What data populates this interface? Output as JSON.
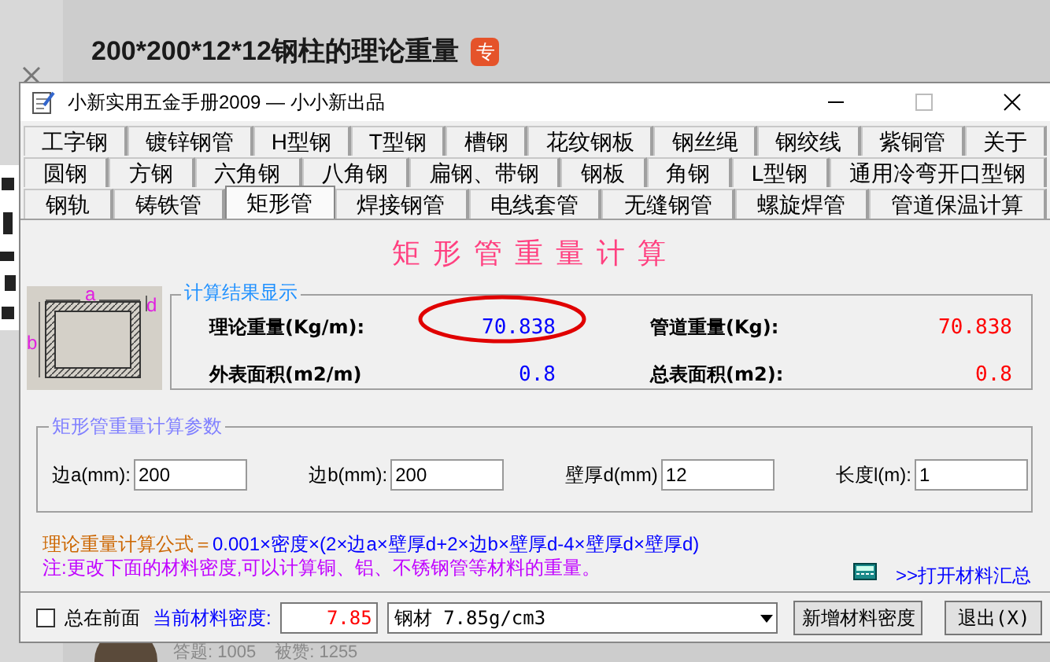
{
  "page": {
    "heading": "200*200*12*12钢柱的理论重量",
    "badge": "专",
    "stats": [
      {
        "label": "答题:",
        "value": "1005"
      },
      {
        "label": "被赞:",
        "value": "1255"
      }
    ]
  },
  "window": {
    "title": "小新实用五金手册2009 — 小小新出品"
  },
  "tab_rows": [
    [
      {
        "label": "工字钢",
        "selected": false
      },
      {
        "label": "镀锌钢管",
        "selected": false
      },
      {
        "label": "H型钢",
        "selected": false
      },
      {
        "label": "T型钢",
        "selected": false
      },
      {
        "label": "槽钢",
        "selected": false
      },
      {
        "label": "花纹钢板",
        "selected": false
      },
      {
        "label": "钢丝绳",
        "selected": false
      },
      {
        "label": "钢绞线",
        "selected": false
      },
      {
        "label": "紫铜管",
        "selected": false
      },
      {
        "label": "关于",
        "selected": false
      }
    ],
    [
      {
        "label": "圆钢",
        "selected": false
      },
      {
        "label": "方钢",
        "selected": false
      },
      {
        "label": "六角钢",
        "selected": false
      },
      {
        "label": "八角钢",
        "selected": false
      },
      {
        "label": "扁钢、带钢",
        "selected": false
      },
      {
        "label": "钢板",
        "selected": false
      },
      {
        "label": "角钢",
        "selected": false
      },
      {
        "label": "L型钢",
        "selected": false
      },
      {
        "label": "通用冷弯开口型钢",
        "selected": false
      }
    ],
    [
      {
        "label": "钢轨",
        "selected": false
      },
      {
        "label": "铸铁管",
        "selected": false
      },
      {
        "label": "矩形管",
        "selected": true
      },
      {
        "label": "焊接钢管",
        "selected": false
      },
      {
        "label": "电线套管",
        "selected": false
      },
      {
        "label": "无缝钢管",
        "selected": false
      },
      {
        "label": "螺旋焊管",
        "selected": false
      },
      {
        "label": "管道保温计算",
        "selected": false
      }
    ]
  ],
  "heading": "矩形管重量计算",
  "diagram_labels": [
    "a",
    "b",
    "d"
  ],
  "results": {
    "title": "计算结果显示",
    "items": [
      {
        "label": "理论重量(Kg/m):",
        "value": "70.838",
        "color": "#0000ff"
      },
      {
        "label": "管道重量(Kg):",
        "value": "70.838",
        "color": "#ff0000"
      },
      {
        "label": "外表面积(m2/m)",
        "value": "0.8",
        "color": "#0000ff"
      },
      {
        "label": "总表面积(m2):",
        "value": "0.8",
        "color": "#ff0000"
      }
    ]
  },
  "params": {
    "title": "矩形管重量计算参数",
    "fields": [
      {
        "label": "边a(mm):",
        "value": "200"
      },
      {
        "label": "边b(mm):",
        "value": "200"
      },
      {
        "label": "壁厚d(mm)",
        "value": "12"
      },
      {
        "label": "长度l(m):",
        "value": "1"
      }
    ]
  },
  "formula": {
    "label": "理论重量计算公式＝",
    "text": "0.001×密度×(2×边a×壁厚d+2×边b×壁厚d-4×壁厚d×壁厚d)"
  },
  "note": "注:更改下面的材料密度,可以计算铜、铝、不锈钢管等材料的重量。",
  "link": ">>打开材料汇总",
  "footer": {
    "always_on_top": {
      "label": "总在前面",
      "checked": false
    },
    "density_label": "当前材料密度:",
    "density_value": "7.85",
    "material": "钢材 7.85g/cm3",
    "buttons": [
      "新增材料密度",
      "退出(X)"
    ]
  }
}
